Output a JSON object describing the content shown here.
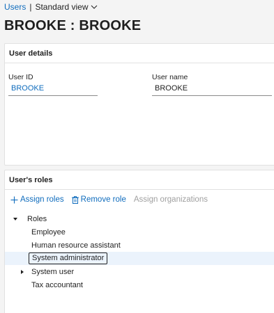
{
  "breadcrumb": {
    "link": "Users",
    "separator": "|",
    "view": "Standard view"
  },
  "page": {
    "title": "BROOKE : BROOKE"
  },
  "user_details": {
    "header": "User details",
    "user_id_label": "User ID",
    "user_id_value": "BROOKE",
    "user_name_label": "User name",
    "user_name_value": "BROOKE"
  },
  "roles": {
    "header": "User's roles",
    "toolbar": {
      "assign_roles": "Assign roles",
      "remove_role": "Remove role",
      "assign_organizations": "Assign organizations"
    },
    "tree": {
      "root_label": "Roles",
      "items": [
        "Employee",
        "Human resource assistant",
        "System administrator",
        "System user",
        "Tax accountant"
      ],
      "selected": "System administrator",
      "expandable": "System user"
    }
  },
  "colors": {
    "link": "#0f6cbd",
    "disabled": "#a0a0a0",
    "selected_row": "#ebf3fc",
    "background": "#f4f4f4"
  }
}
